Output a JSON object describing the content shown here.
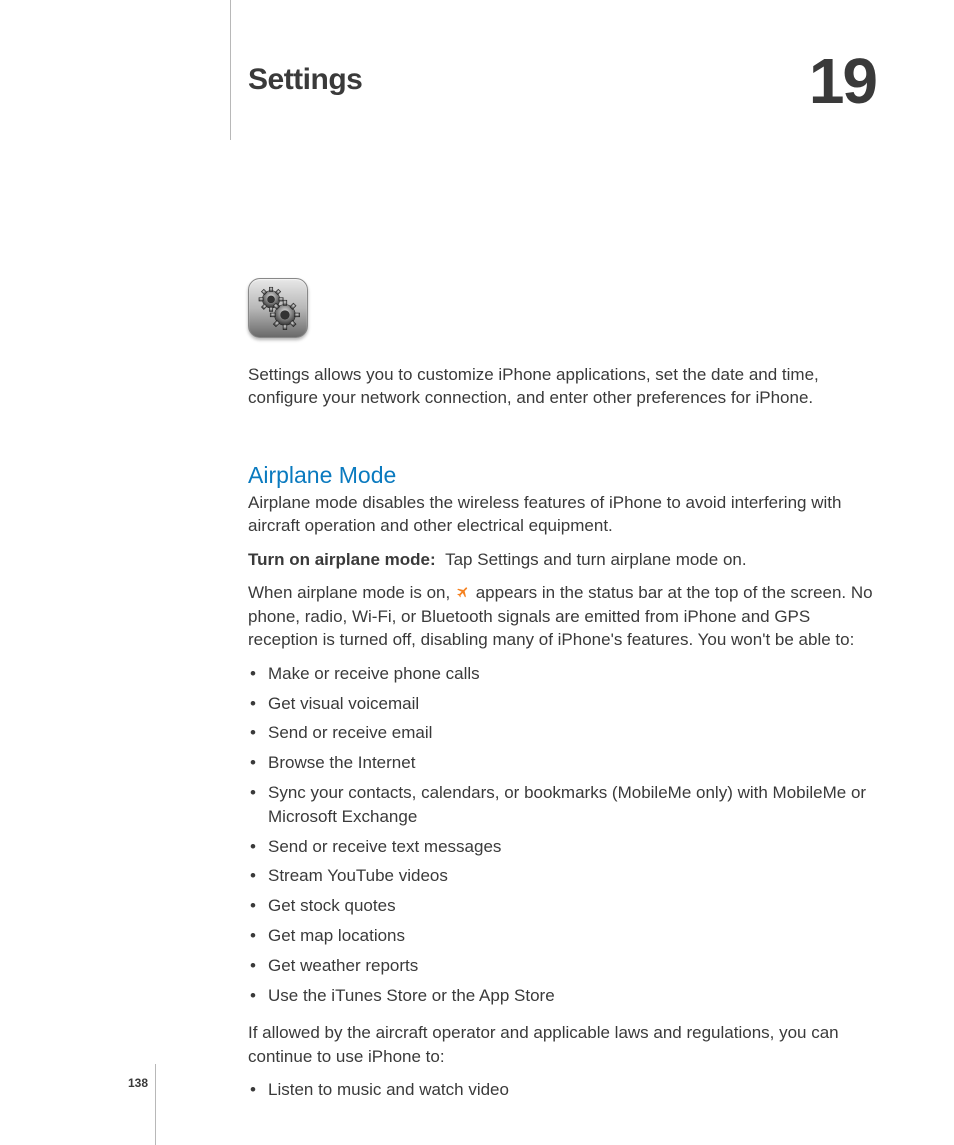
{
  "chapter": {
    "title": "Settings",
    "number": "19"
  },
  "intro": "Settings allows you to customize iPhone applications, set the date and time, configure your network connection, and enter other preferences for iPhone.",
  "section": {
    "heading": "Airplane Mode",
    "description": "Airplane mode disables the wireless features of iPhone to avoid interfering with aircraft operation and other electrical equipment.",
    "instruction_label": "Turn on airplane mode:",
    "instruction_text": "Tap Settings and turn airplane mode on.",
    "when_on_pre": "When airplane mode is on,",
    "when_on_post": "appears in the status bar at the top of the screen. No phone, radio, Wi-Fi, or Bluetooth signals are emitted from iPhone and GPS reception is turned off, disabling many of iPhone's features. You won't be able to:",
    "limitations": [
      "Make or receive phone calls",
      "Get visual voicemail",
      "Send or receive email",
      "Browse the Internet",
      "Sync your contacts, calendars, or bookmarks (MobileMe only) with MobileMe or Microsoft Exchange",
      "Send or receive text messages",
      "Stream YouTube videos",
      "Get stock quotes",
      "Get map locations",
      "Get weather reports",
      "Use the iTunes Store or the App Store"
    ],
    "allowed_intro": "If allowed by the aircraft operator and applicable laws and regulations, you can continue to use iPhone to:",
    "allowed": [
      "Listen to music and watch video"
    ]
  },
  "page_number": "138"
}
